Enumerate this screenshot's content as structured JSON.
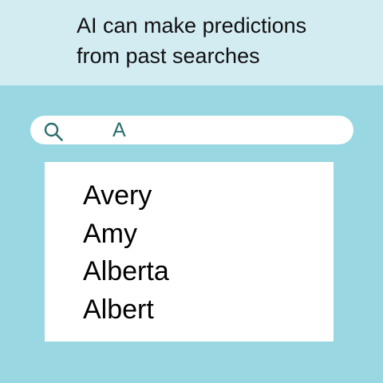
{
  "caption": {
    "line1": "AI can make predictions",
    "line2": "from past searches"
  },
  "search": {
    "value": "A",
    "icon": "search-icon"
  },
  "suggestions": [
    "Avery",
    "Amy",
    "Alberta",
    "Albert"
  ],
  "colors": {
    "background": "#99d7e2",
    "header_background": "#d3ecf2",
    "search_text": "#2b6f6b",
    "icon": "#2b6f6b"
  }
}
